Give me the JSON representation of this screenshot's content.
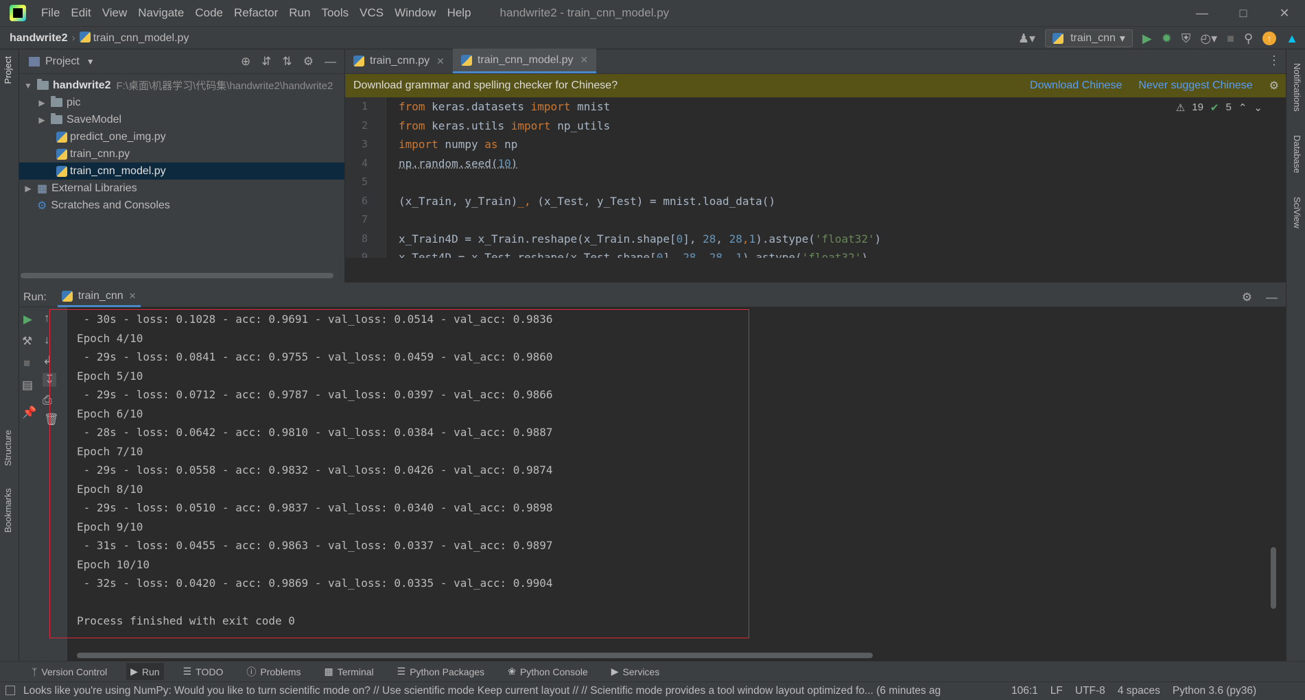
{
  "menubar": {
    "items": [
      "File",
      "Edit",
      "View",
      "Navigate",
      "Code",
      "Refactor",
      "Run",
      "Tools",
      "VCS",
      "Window",
      "Help"
    ],
    "title": "handwrite2 - train_cnn_model.py"
  },
  "navbar": {
    "project": "handwrite2",
    "file": "train_cnn_model.py",
    "run_config": "train_cnn"
  },
  "left_strip": {
    "project": "Project",
    "structure": "Structure",
    "bookmarks": "Bookmarks"
  },
  "right_strip": {
    "notifications": "Notifications",
    "database": "Database",
    "sciview": "SciView"
  },
  "project_panel": {
    "title": "Project",
    "root": "handwrite2",
    "root_path": "F:\\桌面\\机器学习\\代码集\\handwrite2\\handwrite2",
    "items": [
      {
        "label": "pic"
      },
      {
        "label": "SaveModel"
      },
      {
        "label": "predict_one_img.py"
      },
      {
        "label": "train_cnn.py"
      },
      {
        "label": "train_cnn_model.py"
      },
      {
        "label": "External Libraries"
      },
      {
        "label": "Scratches and Consoles"
      }
    ]
  },
  "editor": {
    "tabs": [
      {
        "label": "train_cnn.py"
      },
      {
        "label": "train_cnn_model.py"
      }
    ],
    "banner": {
      "text": "Download grammar and spelling checker for Chinese?",
      "download": "Download Chinese",
      "never": "Never suggest Chinese"
    },
    "inspections": {
      "warnings": "19",
      "ok": "5"
    },
    "line_numbers": [
      "1",
      "2",
      "3",
      "4",
      "5",
      "6",
      "7",
      "8",
      "9"
    ]
  },
  "run_panel": {
    "label": "Run:",
    "tab": "train_cnn",
    "console_lines": [
      " - 30s - loss: 0.1028 - acc: 0.9691 - val_loss: 0.0514 - val_acc: 0.9836",
      "Epoch 4/10",
      " - 29s - loss: 0.0841 - acc: 0.9755 - val_loss: 0.0459 - val_acc: 0.9860",
      "Epoch 5/10",
      " - 29s - loss: 0.0712 - acc: 0.9787 - val_loss: 0.0397 - val_acc: 0.9866",
      "Epoch 6/10",
      " - 28s - loss: 0.0642 - acc: 0.9810 - val_loss: 0.0384 - val_acc: 0.9887",
      "Epoch 7/10",
      " - 29s - loss: 0.0558 - acc: 0.9832 - val_loss: 0.0426 - val_acc: 0.9874",
      "Epoch 8/10",
      " - 29s - loss: 0.0510 - acc: 0.9837 - val_loss: 0.0340 - val_acc: 0.9898",
      "Epoch 9/10",
      " - 31s - loss: 0.0455 - acc: 0.9863 - val_loss: 0.0337 - val_acc: 0.9897",
      "Epoch 10/10",
      " - 32s - loss: 0.0420 - acc: 0.9869 - val_loss: 0.0335 - val_acc: 0.9904",
      "",
      "Process finished with exit code 0"
    ]
  },
  "tool_windows": [
    "Version Control",
    "Run",
    "TODO",
    "Problems",
    "Terminal",
    "Python Packages",
    "Python Console",
    "Services"
  ],
  "status": {
    "message": "Looks like you're using NumPy: Would you like to turn scientific mode on? // Use scientific mode   Keep current layout // // Scientific mode provides a tool window layout optimized fo... (6 minutes ag",
    "position": "106:1",
    "line_sep": "LF",
    "encoding": "UTF-8",
    "indent": "4 spaces",
    "interpreter": "Python 3.6 (py36)"
  },
  "colors": {
    "accent": "#4a88c7",
    "highlight_border": "#e0283b",
    "banner_bg": "#575215"
  }
}
